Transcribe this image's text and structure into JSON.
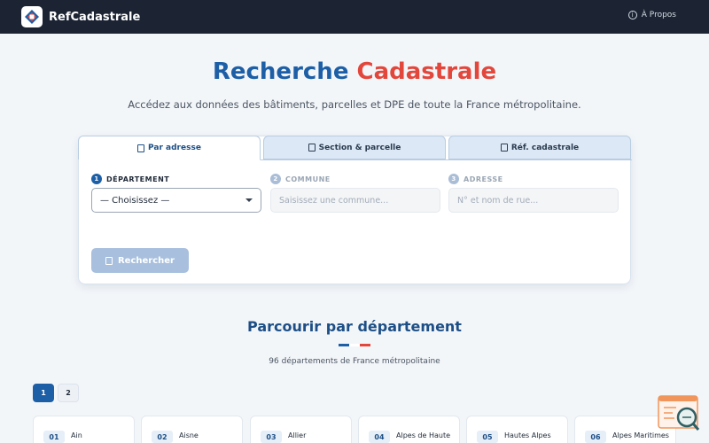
{
  "navbar": {
    "brand": "RefCadastrale",
    "about_label": "À Propos",
    "bg_color": "#1c2434"
  },
  "hero": {
    "title_part1": "Recherche",
    "title_part2": "Cadastrale",
    "subtitle": "Accédez aux données des bâtiments, parcelles et DPE de toute la France métropolitaine."
  },
  "search_card": {
    "tabs": [
      {
        "label": "Par adresse",
        "active": true,
        "icon": "map-pin-icon"
      },
      {
        "label": "Section & parcelle",
        "active": false,
        "icon": "grid-icon"
      },
      {
        "label": "Réf. cadastrale",
        "active": false,
        "icon": "document-icon"
      }
    ],
    "fields": {
      "departement": {
        "step": "1",
        "label": "DÉPARTEMENT",
        "value": "— Choisissez —"
      },
      "commune": {
        "step": "2",
        "label": "COMMUNE",
        "placeholder": "Saisissez une commune..."
      },
      "adresse": {
        "step": "3",
        "label": "ADRESSE",
        "placeholder": "N° et nom de rue..."
      }
    },
    "search_button": "Rechercher"
  },
  "browse": {
    "title": "Parcourir par département",
    "subtitle": "96 départements de France métropolitaine",
    "flag_colors": [
      "#1d5fa6",
      "#ffffff",
      "#e3473c"
    ],
    "pages": [
      "1",
      "2"
    ],
    "current_page": "1",
    "departments": [
      {
        "code": "01",
        "name": "Ain"
      },
      {
        "code": "02",
        "name": "Aisne"
      },
      {
        "code": "03",
        "name": "Allier"
      },
      {
        "code": "04",
        "name": "Alpes de Haute"
      },
      {
        "code": "05",
        "name": "Hautes Alpes"
      },
      {
        "code": "06",
        "name": "Alpes Maritimes"
      }
    ]
  },
  "colors": {
    "accent_blue": "#1d5fa6",
    "accent_red": "#e3473c"
  }
}
